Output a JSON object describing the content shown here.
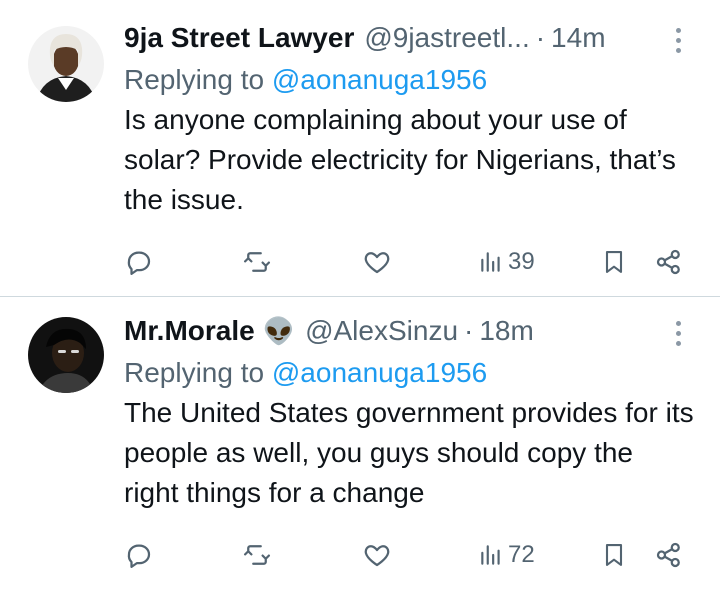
{
  "tweets": [
    {
      "name": "9ja Street Lawyer",
      "handle": "@9jastreetl...",
      "separator": "·",
      "time": "14m",
      "replying_prefix": "Replying to",
      "replying_to": "@aonanuga1956",
      "text": "Is anyone complaining about your use of solar? Provide electricity for Nigerians, that’s the issue.",
      "views": "39",
      "emoji": ""
    },
    {
      "name": "Mr.Morale",
      "emoji": "👽",
      "handle": "@AlexSinzu",
      "separator": "·",
      "time": "18m",
      "replying_prefix": "Replying to",
      "replying_to": "@aonanuga1956",
      "text": "The United States government provides for its people as well, you guys should copy the right things for a change",
      "views": "72"
    }
  ],
  "icons": {
    "reply": "reply-icon",
    "retweet": "retweet-icon",
    "like": "heart-icon",
    "views": "views-icon",
    "bookmark": "bookmark-icon",
    "share": "share-icon",
    "more": "more-vertical-icon"
  },
  "colors": {
    "text": "#0f1419",
    "secondary": "#536471",
    "link": "#1d9bf0",
    "divider": "#cfd9de"
  }
}
